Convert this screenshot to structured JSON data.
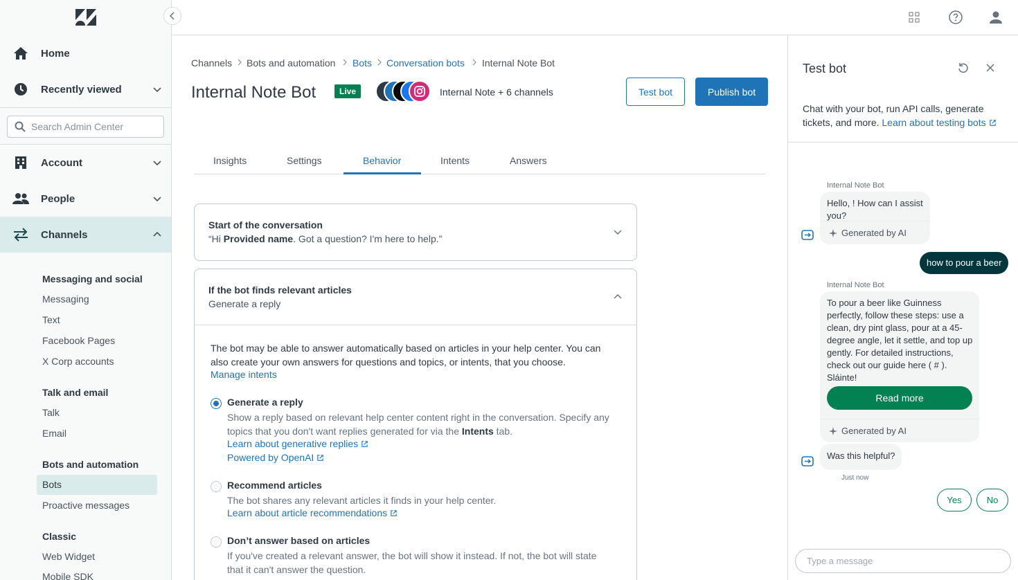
{
  "sidebar": {
    "nav": {
      "home": "Home",
      "recently_viewed": "Recently viewed",
      "account": "Account",
      "people": "People",
      "channels": "Channels"
    },
    "search_placeholder": "Search Admin Center",
    "groups": {
      "messaging_social": {
        "heading": "Messaging and social",
        "items": [
          "Messaging",
          "Text",
          "Facebook Pages",
          "X Corp accounts"
        ]
      },
      "talk_email": {
        "heading": "Talk and email",
        "items": [
          "Talk",
          "Email"
        ]
      },
      "bots_automation": {
        "heading": "Bots and automation",
        "items": [
          "Bots",
          "Proactive messages"
        ]
      },
      "classic": {
        "heading": "Classic",
        "items": [
          "Web Widget",
          "Mobile SDK"
        ]
      }
    }
  },
  "breadcrumb": [
    "Channels",
    "Bots and automation",
    "Bots",
    "Conversation bots",
    "Internal Note Bot"
  ],
  "header": {
    "title": "Internal Note Bot",
    "status": "Live",
    "channels_text": "Internal Note + 6 channels",
    "test_bot": "Test bot",
    "publish_bot": "Publish bot"
  },
  "tabs": [
    "Insights",
    "Settings",
    "Behavior",
    "Intents",
    "Answers"
  ],
  "active_tab": "Behavior",
  "start_section": {
    "title": "Start of the conversation",
    "greeting_open": "“Hi ",
    "greeting_name": "Provided name",
    "greeting_rest": ". Got a question? I'm here to help.”"
  },
  "articles_section": {
    "title": "If the bot finds relevant articles",
    "subtitle": "Generate a reply",
    "description": "The bot may be able to answer automatically based on articles in your help center. You can also create your own answers for questions and topics, or intents, that you choose.",
    "manage_intents": "Manage intents",
    "options": [
      {
        "title": "Generate a reply",
        "desc_before": "Show a reply based on relevant help center content right in the conversation. Specify any topics that you don't want replies generated for via the ",
        "desc_bold": "Intents",
        "desc_after": " tab.",
        "links": [
          "Learn about generative replies",
          "Powered by OpenAI"
        ],
        "selected": true
      },
      {
        "title": "Recommend articles",
        "desc": "The bot shares any relevant articles it finds in your help center.",
        "links": [
          "Learn about article recommendations"
        ],
        "selected": false
      },
      {
        "title": "Don’t answer based on articles",
        "desc": "If you've created a relevant answer, the bot will show it instead. If not, the bot will state that it can't answer the question.",
        "selected": false
      }
    ]
  },
  "test_panel": {
    "title": "Test bot",
    "description": "Chat with your bot, run API calls, generate tickets, and more.",
    "learn_link": "Learn about testing bots",
    "messages": {
      "bot_name": "Internal Note Bot",
      "greeting": "Hello, ! How can I assist you?",
      "generated_label": "Generated by AI",
      "user_message": "how to pour a beer",
      "bot_answer": "To pour a beer like Guinness perfectly, follow these steps: use a clean, dry pint glass, pour at a 45-degree angle, let it settle, and top up gently. For detailed instructions, check out our guide here ( # ). Sláinte!",
      "read_more": "Read more",
      "helpful_question": "Was this helpful?",
      "timestamp": "Just now",
      "quick_replies": [
        "Yes",
        "No"
      ]
    },
    "input_placeholder": "Type a message"
  },
  "colors": {
    "primary": "#1f73b7",
    "live_green": "#038153",
    "user_bubble": "#03363d",
    "active_nav": "#d9ebea"
  }
}
